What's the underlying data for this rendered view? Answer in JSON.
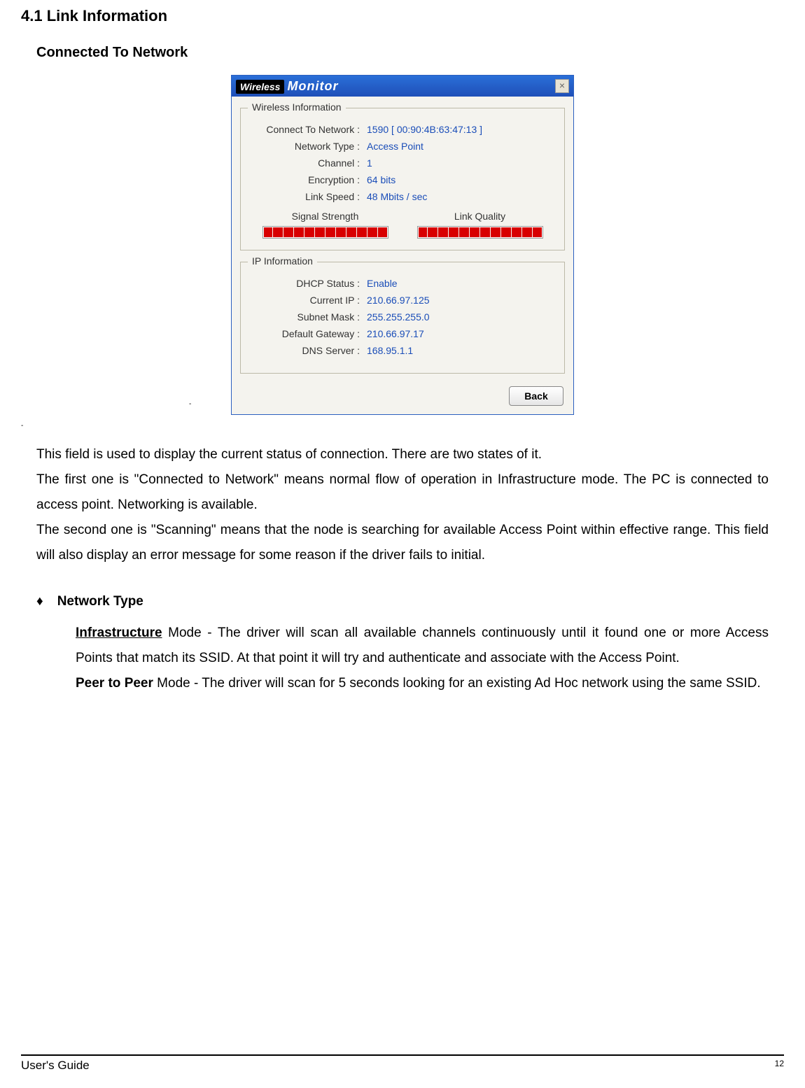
{
  "section_heading": "4.1 Link Information",
  "sub_heading": "Connected To Network",
  "dialog": {
    "title_wireless": "Wireless",
    "title_monitor": "Monitor",
    "close_label": "×",
    "wireless_group": {
      "legend": "Wireless Information",
      "rows": [
        {
          "label": "Connect To Network :",
          "value": "1590 [ 00:90:4B:63:47:13 ]"
        },
        {
          "label": "Network Type :",
          "value": "Access Point"
        },
        {
          "label": "Channel :",
          "value": "1"
        },
        {
          "label": "Encryption :",
          "value": "64 bits"
        },
        {
          "label": "Link Speed :",
          "value": "48 Mbits / sec"
        }
      ],
      "signal_label": "Signal Strength",
      "quality_label": "Link Quality",
      "signal_pct": 100,
      "quality_pct": 100
    },
    "ip_group": {
      "legend": "IP Information",
      "rows": [
        {
          "label": "DHCP Status :",
          "value": "Enable"
        },
        {
          "label": "Current IP :",
          "value": "210.66.97.125"
        },
        {
          "label": "Subnet Mask :",
          "value": "255.255.255.0"
        },
        {
          "label": "Default Gateway :",
          "value": "210.66.97.17"
        },
        {
          "label": "DNS Server :",
          "value": "168.95.1.1"
        }
      ]
    },
    "back_label": "Back"
  },
  "body": {
    "p1": "This field is used to display the current status of connection. There are two states of it.",
    "p2": "The first one is \"Connected to Network\" means normal flow of operation in Infrastructure mode. The PC is connected to access point.  Networking is available.",
    "p3": "The second one is \"Scanning\" means that the node is searching for available Access Point within effective range. This field will also display an error message for some reason if the driver fails to initial."
  },
  "bullet": {
    "diamond": "♦",
    "head": "Network Type",
    "infra_label": "Infrastructure",
    "infra_text": " Mode    - The driver will scan all available channels continuously until it found one or more Access Points that match its SSID.  At that point it will try and authenticate and associate with the Access Point.",
    "p2p_label": " Peer to Peer",
    "p2p_text": " Mode  - The driver will scan for 5 seconds looking for an existing Ad Hoc network using the same SSID."
  },
  "footer": {
    "guide": "User's Guide",
    "page": "12"
  },
  "dash": "-"
}
